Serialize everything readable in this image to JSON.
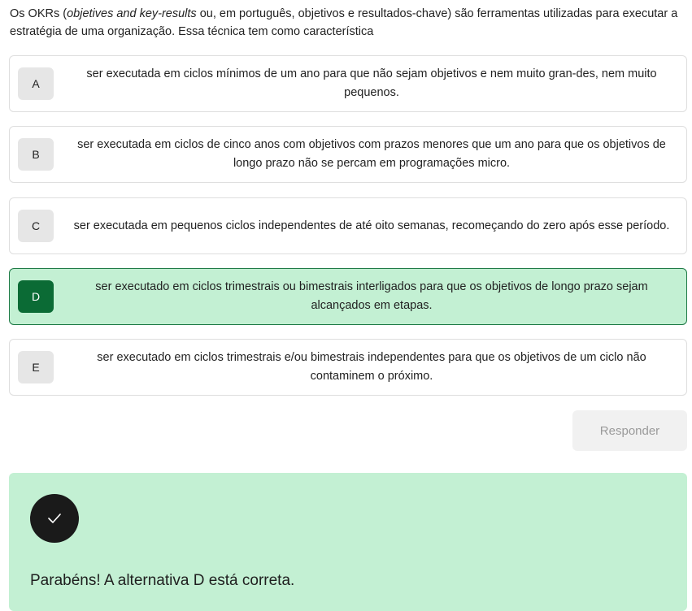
{
  "question": {
    "prefix": "Os OKRs (",
    "italic": "objetives and key-results",
    "suffix": " ou, em português, objetivos e resultados-chave) são ferramentas utilizadas para executar a estratégia de uma organização. Essa técnica tem como característica"
  },
  "options": [
    {
      "letter": "A",
      "text": "ser executada em ciclos mínimos de um ano para que não sejam objetivos e nem muito gran-des, nem muito pequenos."
    },
    {
      "letter": "B",
      "text": "ser executada em ciclos de cinco anos com objetivos com prazos menores que um ano para que os objetivos de longo prazo não se percam em programações micro."
    },
    {
      "letter": "C",
      "text": "ser executada em pequenos ciclos independentes de até oito semanas, recomeçando do zero após esse período."
    },
    {
      "letter": "D",
      "text": "ser executado em ciclos trimestrais ou bimestrais interligados para que os objetivos de longo prazo sejam alcançados em etapas."
    },
    {
      "letter": "E",
      "text": "ser executado em ciclos trimestrais e/ou bimestrais independentes para que os objetivos de um ciclo não contaminem o próximo."
    }
  ],
  "selected_option": "D",
  "submit": {
    "label": "Responder"
  },
  "feedback": {
    "icon": "check-icon",
    "text": "Parabéns! A alternativa D está correta."
  },
  "colors": {
    "selected_background": "#c3f0d3",
    "selected_border": "#1e7a46",
    "selected_letter": "#0b6b35",
    "feedback_background": "#c3f0d3"
  }
}
